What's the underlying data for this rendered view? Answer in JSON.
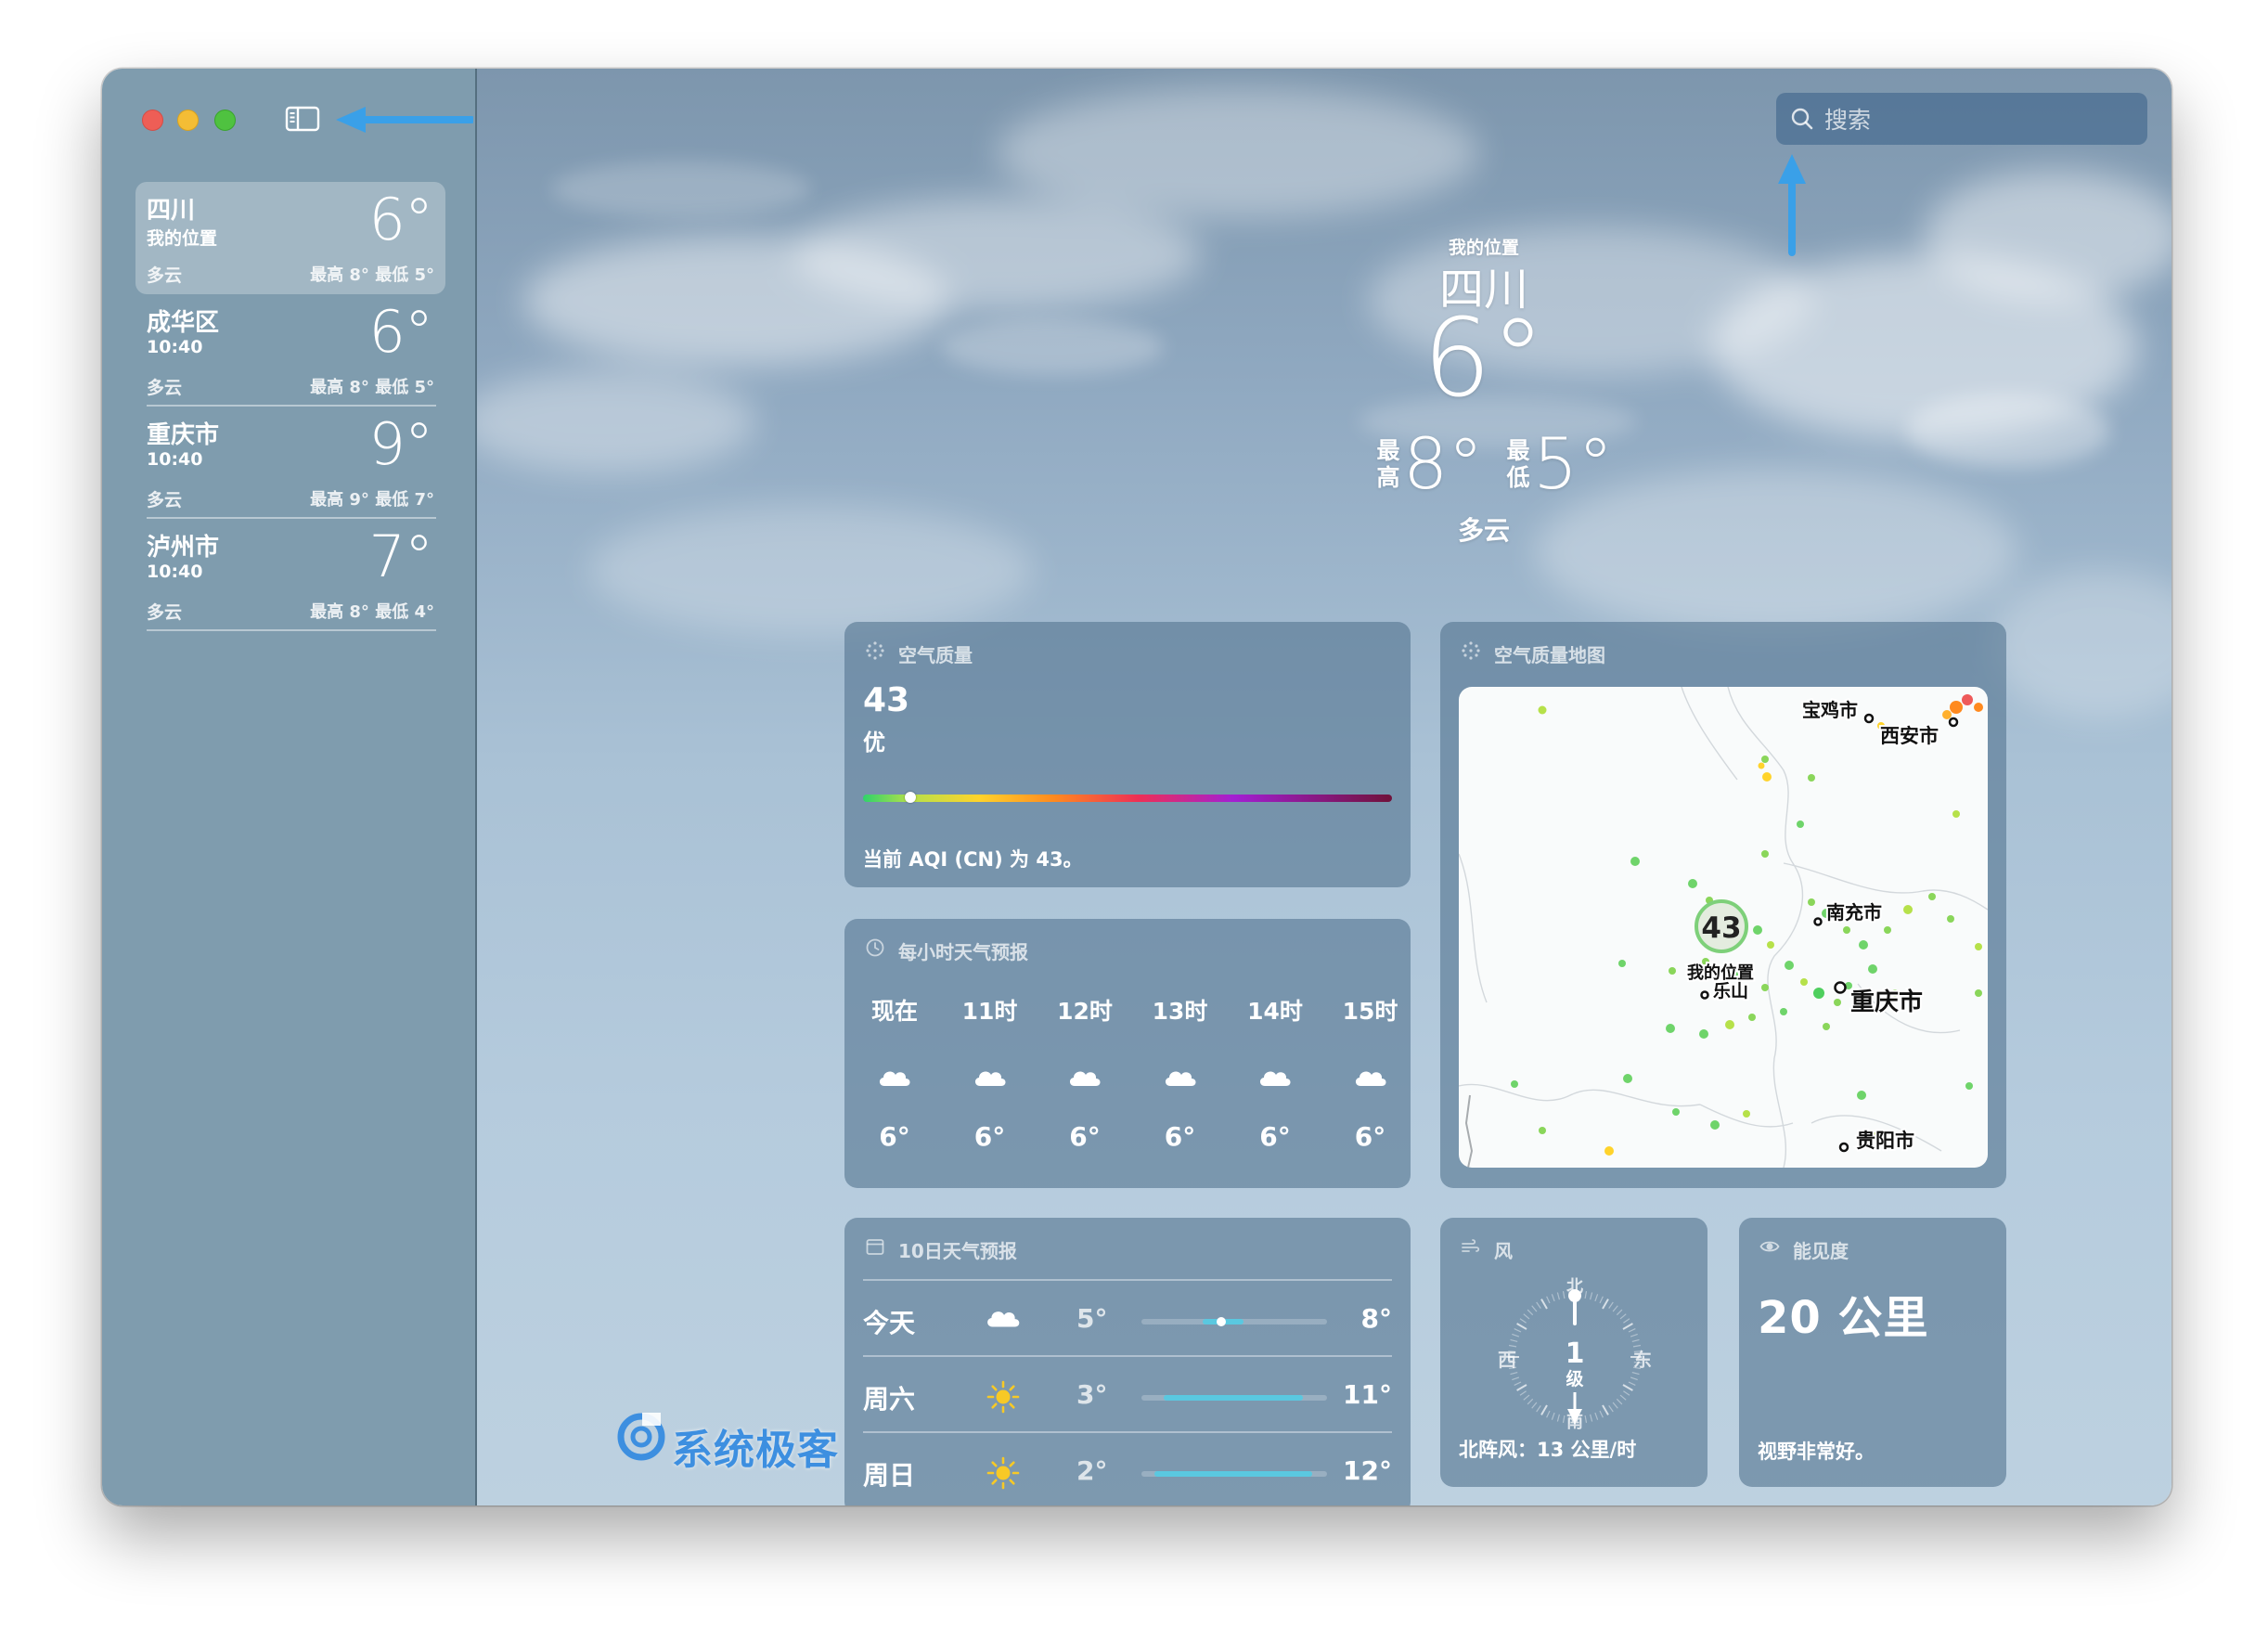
{
  "search": {
    "placeholder": "搜索"
  },
  "sidebar": {
    "locations": [
      {
        "name": "四川",
        "sub": "我的位置",
        "temp": "6°",
        "condition": "多云",
        "hilo": "最高 8°  最低 5°",
        "selected": true
      },
      {
        "name": "成华区",
        "sub": "10:40",
        "temp": "6°",
        "condition": "多云",
        "hilo": "最高 8°  最低 5°",
        "selected": false
      },
      {
        "name": "重庆市",
        "sub": "10:40",
        "temp": "9°",
        "condition": "多云",
        "hilo": "最高 9°  最低 7°",
        "selected": false
      },
      {
        "name": "泸州市",
        "sub": "10:40",
        "temp": "7°",
        "condition": "多云",
        "hilo": "最高 8°  最低 4°",
        "selected": false
      }
    ]
  },
  "hero": {
    "label": "我的位置",
    "city": "四川",
    "temp": "6°",
    "high_caption": "最高",
    "high": "8°",
    "low_caption": "最低",
    "low": "5°",
    "condition": "多云"
  },
  "aqi": {
    "title": "空气质量",
    "value": "43",
    "level": "优",
    "description": "当前 AQI (CN) 为 43。",
    "bar_position": 0.09
  },
  "aqi_map": {
    "title": "空气质量地图",
    "marker_value": "43",
    "marker_label": "我的位置",
    "cities": {
      "baoji": "宝鸡市",
      "xian": "西安市",
      "nanchong": "南充市",
      "leshan": "乐山",
      "chongqing": "重庆市",
      "guiyang": "贵阳市"
    }
  },
  "hourly": {
    "title": "每小时天气预报",
    "items": [
      {
        "label": "现在",
        "icon": "cloud-icon",
        "temp": "6°"
      },
      {
        "label": "11时",
        "icon": "cloud-icon",
        "temp": "6°"
      },
      {
        "label": "12时",
        "icon": "cloud-icon",
        "temp": "6°"
      },
      {
        "label": "13时",
        "icon": "cloud-icon",
        "temp": "6°"
      },
      {
        "label": "14时",
        "icon": "cloud-icon",
        "temp": "6°"
      },
      {
        "label": "15时",
        "icon": "cloud-icon",
        "temp": "6°"
      }
    ]
  },
  "daily": {
    "title": "10日天气预报",
    "days": [
      {
        "name": "今天",
        "icon": "cloud-icon",
        "low": "5°",
        "high": "8°",
        "range_start": 0.33,
        "range_end": 0.55,
        "current": 0.43
      },
      {
        "name": "周六",
        "icon": "sun-icon",
        "low": "3°",
        "high": "11°",
        "range_start": 0.12,
        "range_end": 0.87
      },
      {
        "name": "周日",
        "icon": "sun-icon",
        "low": "2°",
        "high": "12°",
        "range_start": 0.07,
        "range_end": 0.92
      }
    ]
  },
  "wind": {
    "title": "风",
    "level_number": "1",
    "level_unit": "级",
    "north": "北",
    "south": "南",
    "east": "东",
    "west": "西",
    "description": "北阵风：13 公里/时"
  },
  "visibility": {
    "title": "能见度",
    "value": "20 公里",
    "description": "视野非常好。"
  },
  "watermark": {
    "text": "系统极客"
  },
  "colors": {
    "annotation_arrow": "#3aa0e8",
    "aqi_green": "#2fd36a",
    "daily_bar": "#5ac8e0",
    "watermark": "#3d8fe0"
  }
}
